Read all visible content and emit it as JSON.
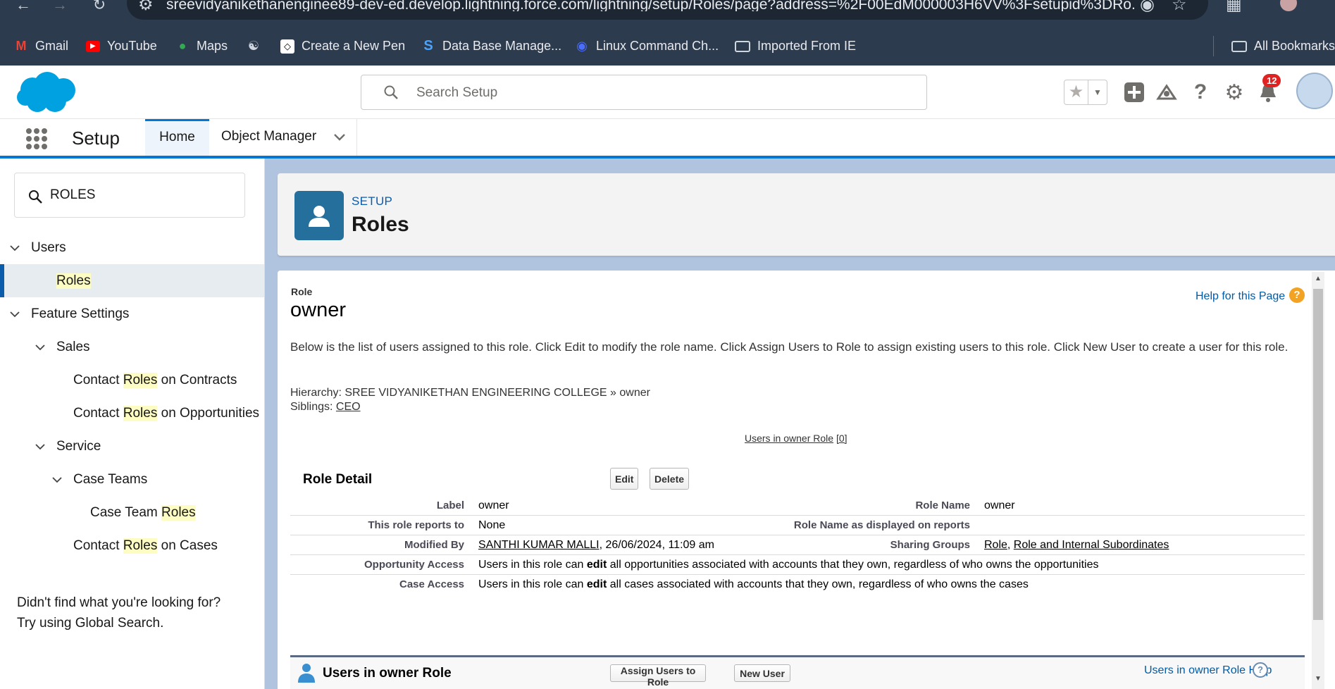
{
  "browser": {
    "url": "sreevidyanikethanenginee89-dev-ed.develop.lightning.force.com/lightning/setup/Roles/page?address=%2F00EdM000003H6VV%3Fsetupid%3DRo...",
    "bookmarks": [
      {
        "label": "Gmail",
        "icon": "gmail-icon"
      },
      {
        "label": "YouTube",
        "icon": "youtube-icon"
      },
      {
        "label": "Maps",
        "icon": "maps-icon"
      },
      {
        "label": "",
        "icon": "globe-icon"
      },
      {
        "label": "Create a New Pen",
        "icon": "codepen-icon"
      },
      {
        "label": "Data Base Manage...",
        "icon": "s-logo-icon"
      },
      {
        "label": "Linux Command Ch...",
        "icon": "linux-icon"
      },
      {
        "label": "Imported From IE",
        "icon": "folder-icon"
      }
    ],
    "all_bookmarks": "All Bookmarks"
  },
  "header": {
    "search_placeholder": "Search Setup",
    "notification_count": "12"
  },
  "context_bar": {
    "app_name": "Setup",
    "tabs": [
      {
        "label": "Home",
        "active": true
      },
      {
        "label": "Object Manager",
        "active": false
      }
    ]
  },
  "sidebar": {
    "search_value": "ROLES",
    "help_text_1": "Didn't find what you're looking for?",
    "help_text_2": "Try using Global Search.",
    "highlight_term": "Roles",
    "items": [
      {
        "before": "Users",
        "hl": "",
        "after": ""
      },
      {
        "before": "",
        "hl": "Roles",
        "after": ""
      },
      {
        "before": "Feature Settings",
        "hl": "",
        "after": ""
      },
      {
        "before": "Sales",
        "hl": "",
        "after": ""
      },
      {
        "before": "Contact ",
        "hl": "Roles",
        "after": " on Contracts"
      },
      {
        "before": "Contact ",
        "hl": "Roles",
        "after": " on Opportunities"
      },
      {
        "before": "Service",
        "hl": "",
        "after": ""
      },
      {
        "before": "Case Teams",
        "hl": "",
        "after": ""
      },
      {
        "before": "Case Team ",
        "hl": "Roles",
        "after": ""
      },
      {
        "before": "Contact ",
        "hl": "Roles",
        "after": " on Cases"
      }
    ]
  },
  "page_header": {
    "breadcrumb": "SETUP",
    "title": "Roles"
  },
  "content": {
    "small_label": "Role",
    "role_name": "owner",
    "help_link": "Help for this Page",
    "description": "Below is the list of users assigned to this role. Click Edit to modify the role name. Click Assign Users to Role to assign existing users to this role. Click New User to create a user for this role.",
    "hierarchy": "Hierarchy: SREE VIDYANIKETHAN ENGINEERING COLLEGE » owner",
    "siblings_label": "Siblings: ",
    "siblings_value": "CEO",
    "users_link": "Users in owner Role",
    "users_count": "[0]",
    "detail": {
      "title": "Role Detail",
      "edit_label": "Edit",
      "delete_label": "Delete",
      "label_label": "Label",
      "label_value": "owner",
      "role_name_label": "Role Name",
      "role_name_value": "owner",
      "reports_to_label": "This role reports to",
      "reports_to_value": "None",
      "display_name_label": "Role Name as displayed on reports",
      "display_name_value": "",
      "modified_by_label": "Modified By",
      "modified_by_user": "SANTHI KUMAR MALLI",
      "modified_by_date": ", 26/06/2024, 11:09 am",
      "sharing_groups_label": "Sharing Groups",
      "sharing_group_1": "Role",
      "sharing_group_2": "Role and Internal Subordinates",
      "opp_access_label": "Opportunity Access",
      "opp_access_pre": "Users in this role can ",
      "opp_access_bold": "edit",
      "opp_access_post": " all opportunities associated with accounts that they own, regardless of who owns the opportunities",
      "case_access_label": "Case Access",
      "case_access_pre": "Users in this role can ",
      "case_access_bold": "edit",
      "case_access_post": " all cases associated with accounts that they own, regardless of who owns the cases"
    },
    "users_block": {
      "title": "Users in owner Role",
      "assign_label": "Assign Users to Role",
      "new_user_label": "New User",
      "help_link": "Users in owner Role Help"
    }
  }
}
